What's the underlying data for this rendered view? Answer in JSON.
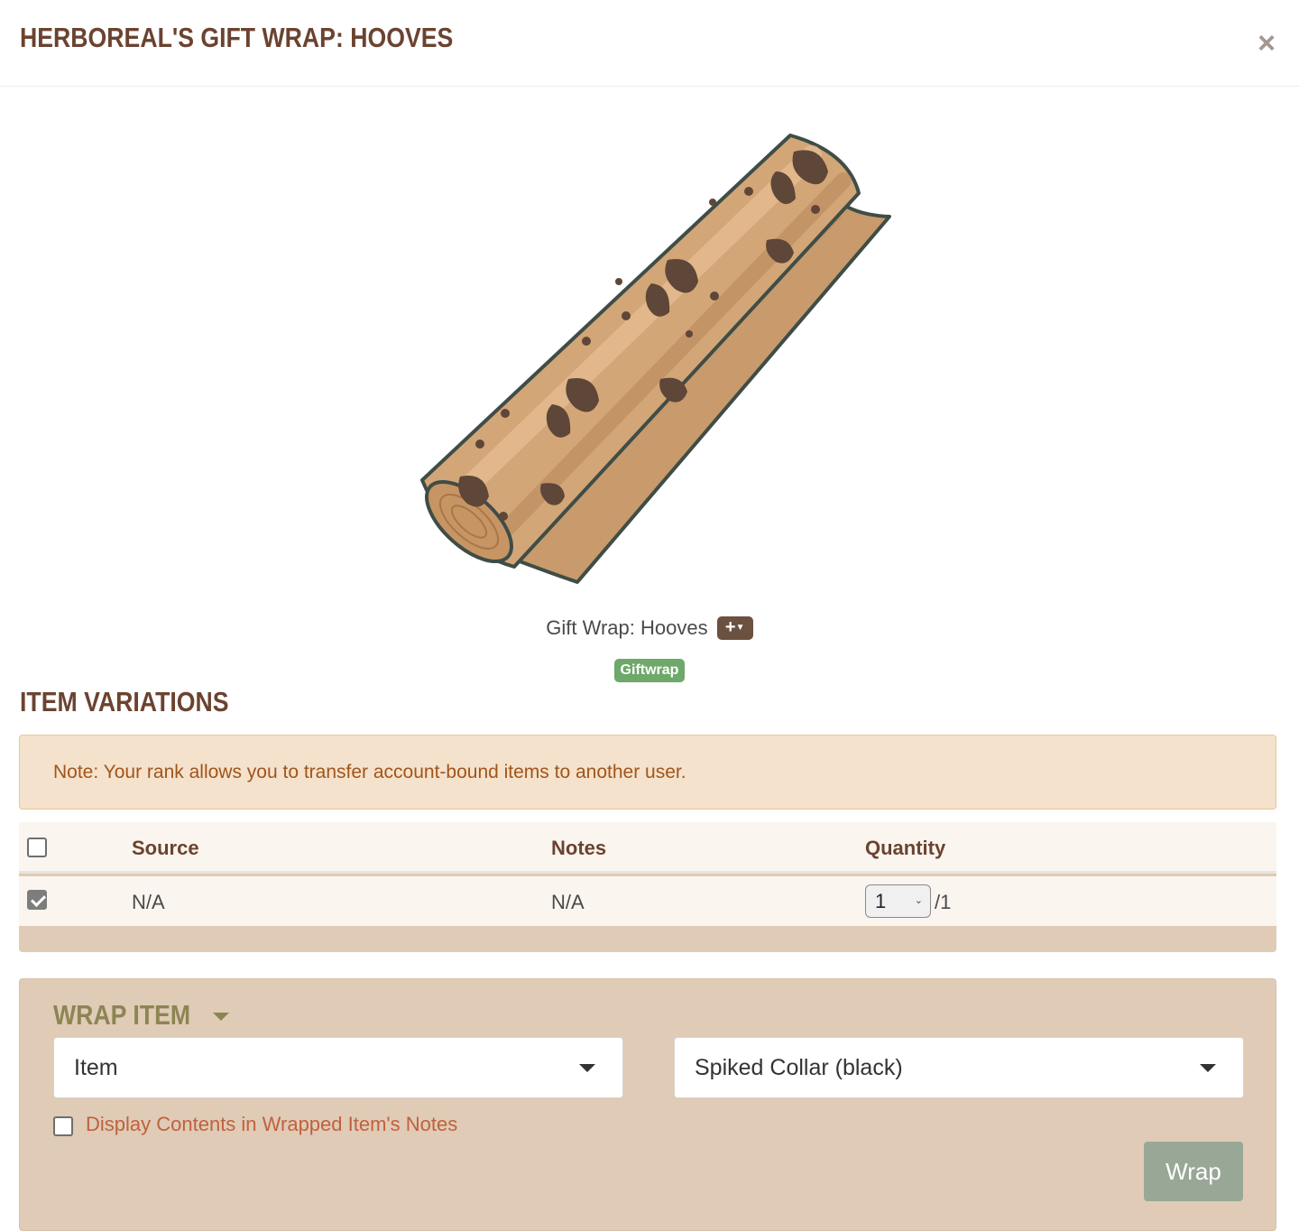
{
  "modal": {
    "title": "HERBOREAL'S GIFT WRAP: HOOVES",
    "close_label": "×"
  },
  "item": {
    "name": "Gift Wrap: Hooves",
    "add_button_label": "+",
    "tag": "Giftwrap"
  },
  "variations": {
    "title": "ITEM VARIATIONS",
    "note": "Note: Your rank allows you to transfer account-bound items to another user.",
    "columns": [
      "Source",
      "Notes",
      "Quantity"
    ],
    "rows": [
      {
        "checked": true,
        "source": "N/A",
        "notes": "N/A",
        "quantity_selected": "1",
        "quantity_max": "/1"
      }
    ]
  },
  "wrap": {
    "title": "WRAP ITEM",
    "type_select": "Item",
    "item_select": "Spiked Collar (black)",
    "display_contents_label": "Display Contents in Wrapped Item's Notes",
    "display_contents_checked": false,
    "wrap_button": "Wrap"
  },
  "colors": {
    "title": "#6b4330",
    "alert_bg": "#f4e2cc",
    "alert_text": "#a2541a",
    "panel_bg": "#dfcbb6",
    "tag_bg": "#6ea86b",
    "wrap_title": "#8c8553",
    "wrap_button": "#99a896"
  }
}
